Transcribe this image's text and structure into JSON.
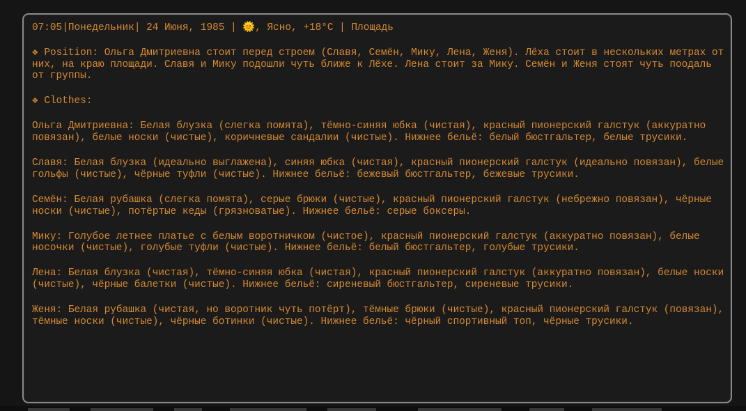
{
  "header": {
    "time": "07:05",
    "day": "Понедельник",
    "date": "24 Июня, 1985",
    "weather_icon": "sun-icon",
    "weather_glyph": "🌞",
    "weather": "Ясно, +18°C",
    "location": "Площадь"
  },
  "position": {
    "label": "Position:",
    "text": "Ольга Дмитриевна стоит перед строем (Славя, Семён, Мику, Лена, Женя). Лёха стоит в нескольких метрах от них, на краю площади. Славя и Мику подошли чуть ближе к Лёхе. Лена стоит за Мику. Семён и Женя стоят чуть поодаль от группы."
  },
  "clothes": {
    "label": "Clothes:",
    "items": [
      {
        "name": "Ольга Дмитриевна:",
        "text": "Белая блузка (слегка помята), тёмно-синяя юбка (чистая), красный пионерский галстук (аккуратно повязан), белые носки (чистые), коричневые сандалии (чистые). Нижнее бельё: белый бюстгальтер, белые трусики."
      },
      {
        "name": "Славя:",
        "text": "Белая блузка (идеально выглажена), синяя юбка (чистая), красный пионерский галстук (идеально повязан), белые гольфы (чистые), чёрные туфли (чистые). Нижнее бельё: бежевый бюстгальтер, бежевые трусики."
      },
      {
        "name": "Семён:",
        "text": "Белая рубашка (слегка помята), серые брюки (чистые), красный пионерский галстук (небрежно повязан), чёрные носки (чистые), потёртые кеды (грязноватые). Нижнее бельё: серые боксеры."
      },
      {
        "name": "Мику:",
        "text": "Голубое летнее платье с белым воротничком (чистое), красный пионерский галстук (аккуратно повязан), белые носочки (чистые), голубые туфли (чистые). Нижнее бельё: белый бюстгальтер, голубые трусики."
      },
      {
        "name": "Лена:",
        "text": "Белая блузка (чистая), тёмно-синяя юбка (чистая), красный пионерский галстук (аккуратно повязан), белые носки (чистые), чёрные балетки (чистые). Нижнее бельё: сиреневый бюстгальтер, сиреневые трусики."
      },
      {
        "name": "Женя:",
        "text": "Белая рубашка (чистая, но воротник чуть потёрт), тёмные брюки (чистые), красный пионерский галстук (повязан), тёмные носки (чистые), чёрные ботинки (чистые). Нижнее бельё: чёрный спортивный топ, чёрные трусики."
      }
    ]
  },
  "bullet_glyph": "❖",
  "colors": {
    "text": "#d58a33",
    "background": "#1b1b1b",
    "border": "#8a8a8a"
  }
}
